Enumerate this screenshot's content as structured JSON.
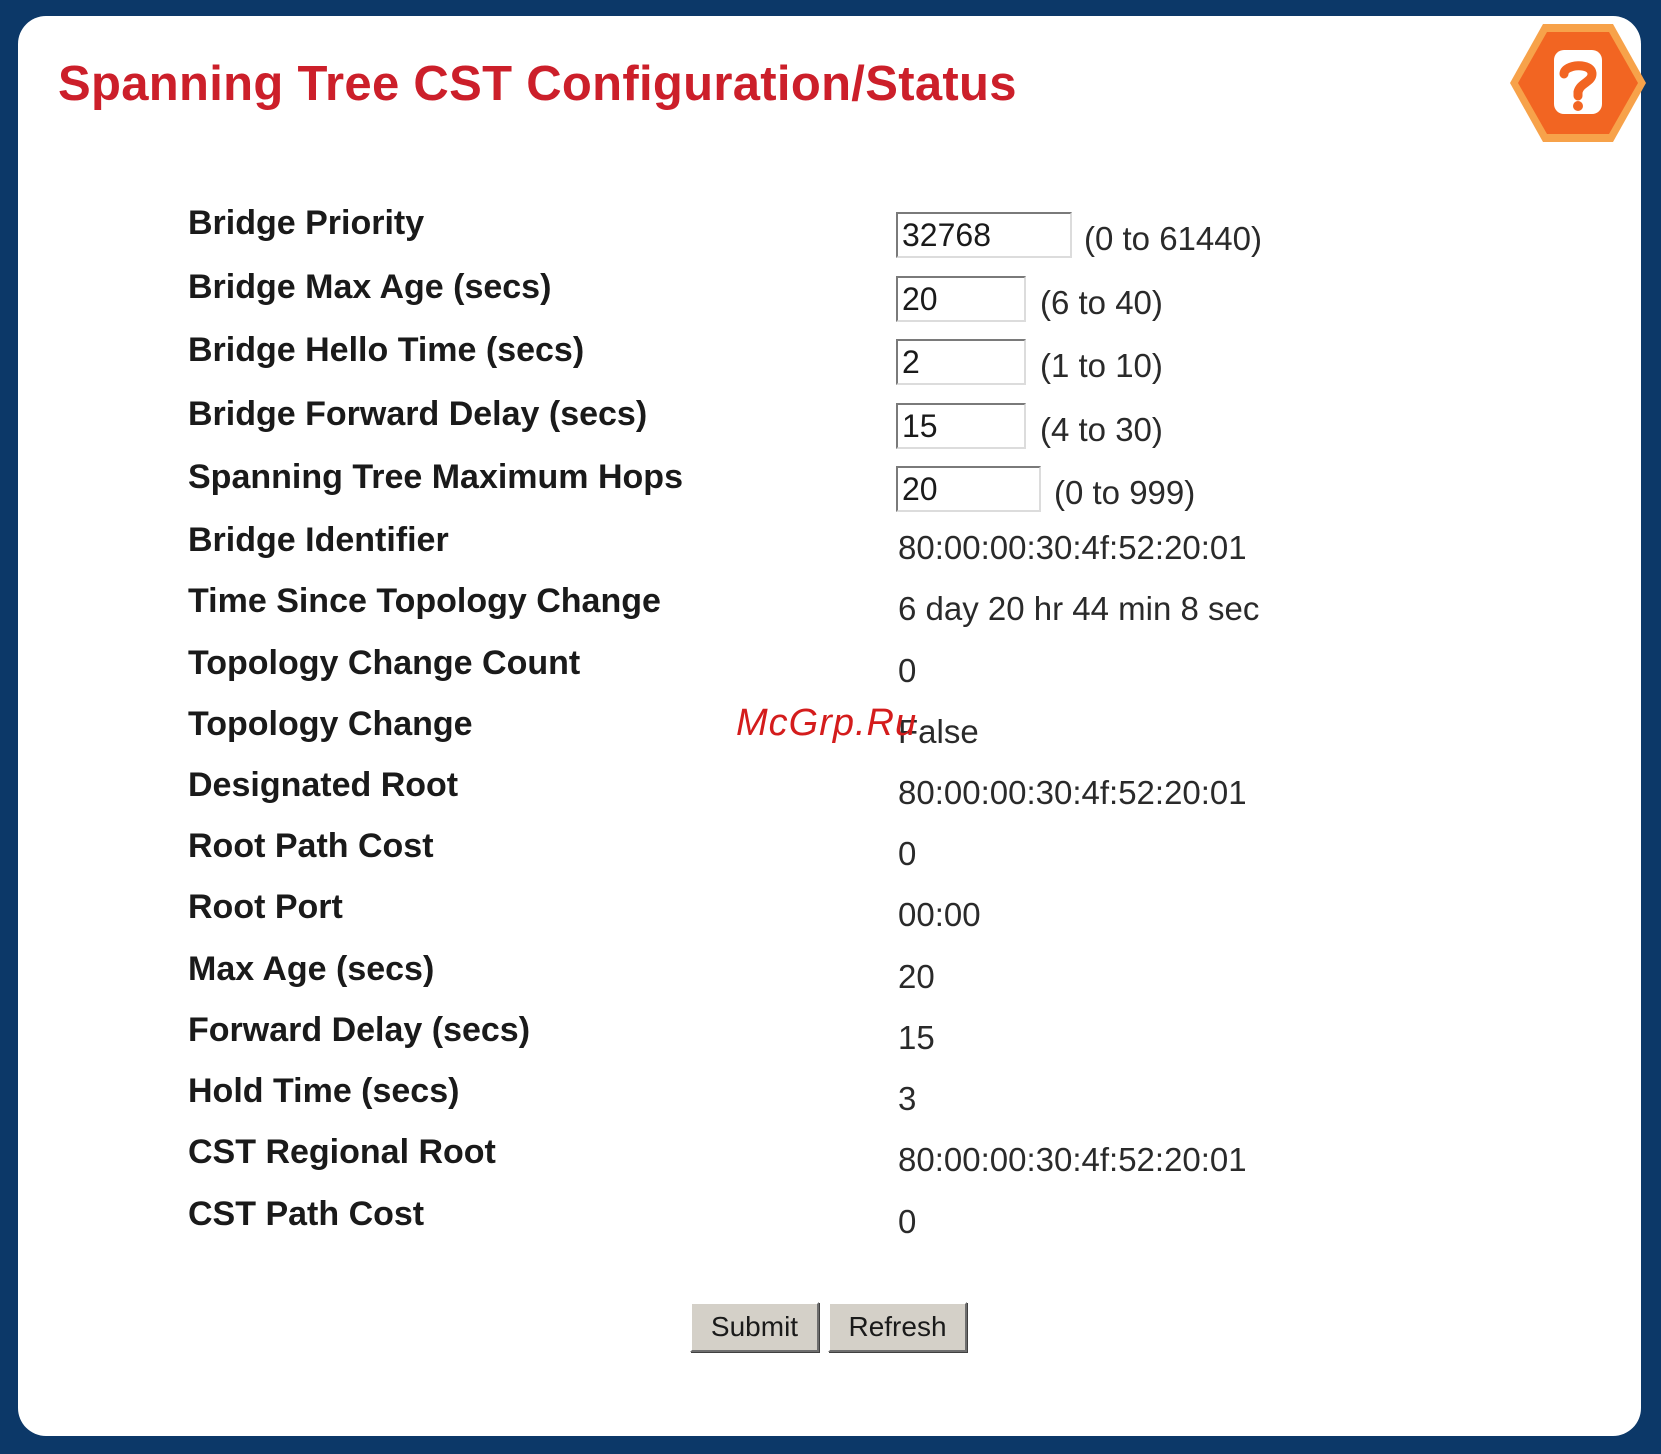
{
  "page": {
    "title": "Spanning Tree CST Configuration/Status"
  },
  "help_icon": {
    "symbol": "?",
    "color_outer": "#f08a24",
    "color_inner": "#f26522"
  },
  "config_fields": [
    {
      "label": "Bridge Priority",
      "value": "32768",
      "range": "(0 to 61440)"
    },
    {
      "label": "Bridge Max Age (secs)",
      "value": "20",
      "range": "(6 to 40)"
    },
    {
      "label": "Bridge Hello Time (secs)",
      "value": "2",
      "range": "(1 to 10)"
    },
    {
      "label": "Bridge Forward Delay (secs)",
      "value": "15",
      "range": "(4 to 30)"
    },
    {
      "label": "Spanning Tree Maximum Hops",
      "value": "20",
      "range": "(0 to 999)"
    }
  ],
  "status_fields": [
    {
      "label": "Bridge Identifier",
      "value": "80:00:00:30:4f:52:20:01"
    },
    {
      "label": "Time Since Topology Change",
      "value": "6 day 20 hr 44 min 8 sec"
    },
    {
      "label": "Topology Change Count",
      "value": "0"
    },
    {
      "label": "Topology Change",
      "value": "False"
    },
    {
      "label": "Designated Root",
      "value": "80:00:00:30:4f:52:20:01"
    },
    {
      "label": "Root Path Cost",
      "value": "0"
    },
    {
      "label": "Root Port",
      "value": "00:00"
    },
    {
      "label": "Max Age (secs)",
      "value": "20"
    },
    {
      "label": "Forward Delay (secs)",
      "value": "15"
    },
    {
      "label": "Hold Time (secs)",
      "value": "3"
    },
    {
      "label": "CST Regional Root",
      "value": "80:00:00:30:4f:52:20:01"
    },
    {
      "label": "CST Path Cost",
      "value": "0"
    }
  ],
  "buttons": {
    "submit": "Submit",
    "refresh": "Refresh"
  },
  "watermark": "McGrp.Ru",
  "colors": {
    "frame": "#0c3868",
    "title": "#cc1f2a",
    "button_face": "#d4d0c8"
  }
}
